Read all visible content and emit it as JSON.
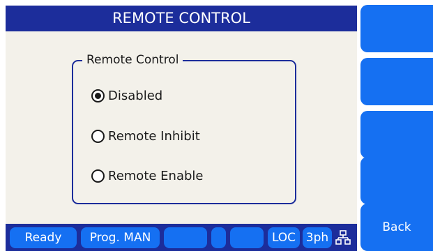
{
  "header": {
    "title": "REMOTE CONTROL"
  },
  "group": {
    "legend": "Remote Control",
    "options": [
      {
        "label": "Disabled",
        "selected": true
      },
      {
        "label": "Remote Inhibit",
        "selected": false
      },
      {
        "label": "Remote Enable",
        "selected": false
      }
    ]
  },
  "softkeys": [
    "",
    "",
    "",
    "",
    "Back"
  ],
  "status": {
    "state": "Ready",
    "program": "Prog. MAN",
    "mode": "LOC",
    "phase": "3ph",
    "icon": "network-icon"
  },
  "colors": {
    "title_bar": "#1c2d9b",
    "button": "#1570f2",
    "panel": "#f3f1ea"
  }
}
